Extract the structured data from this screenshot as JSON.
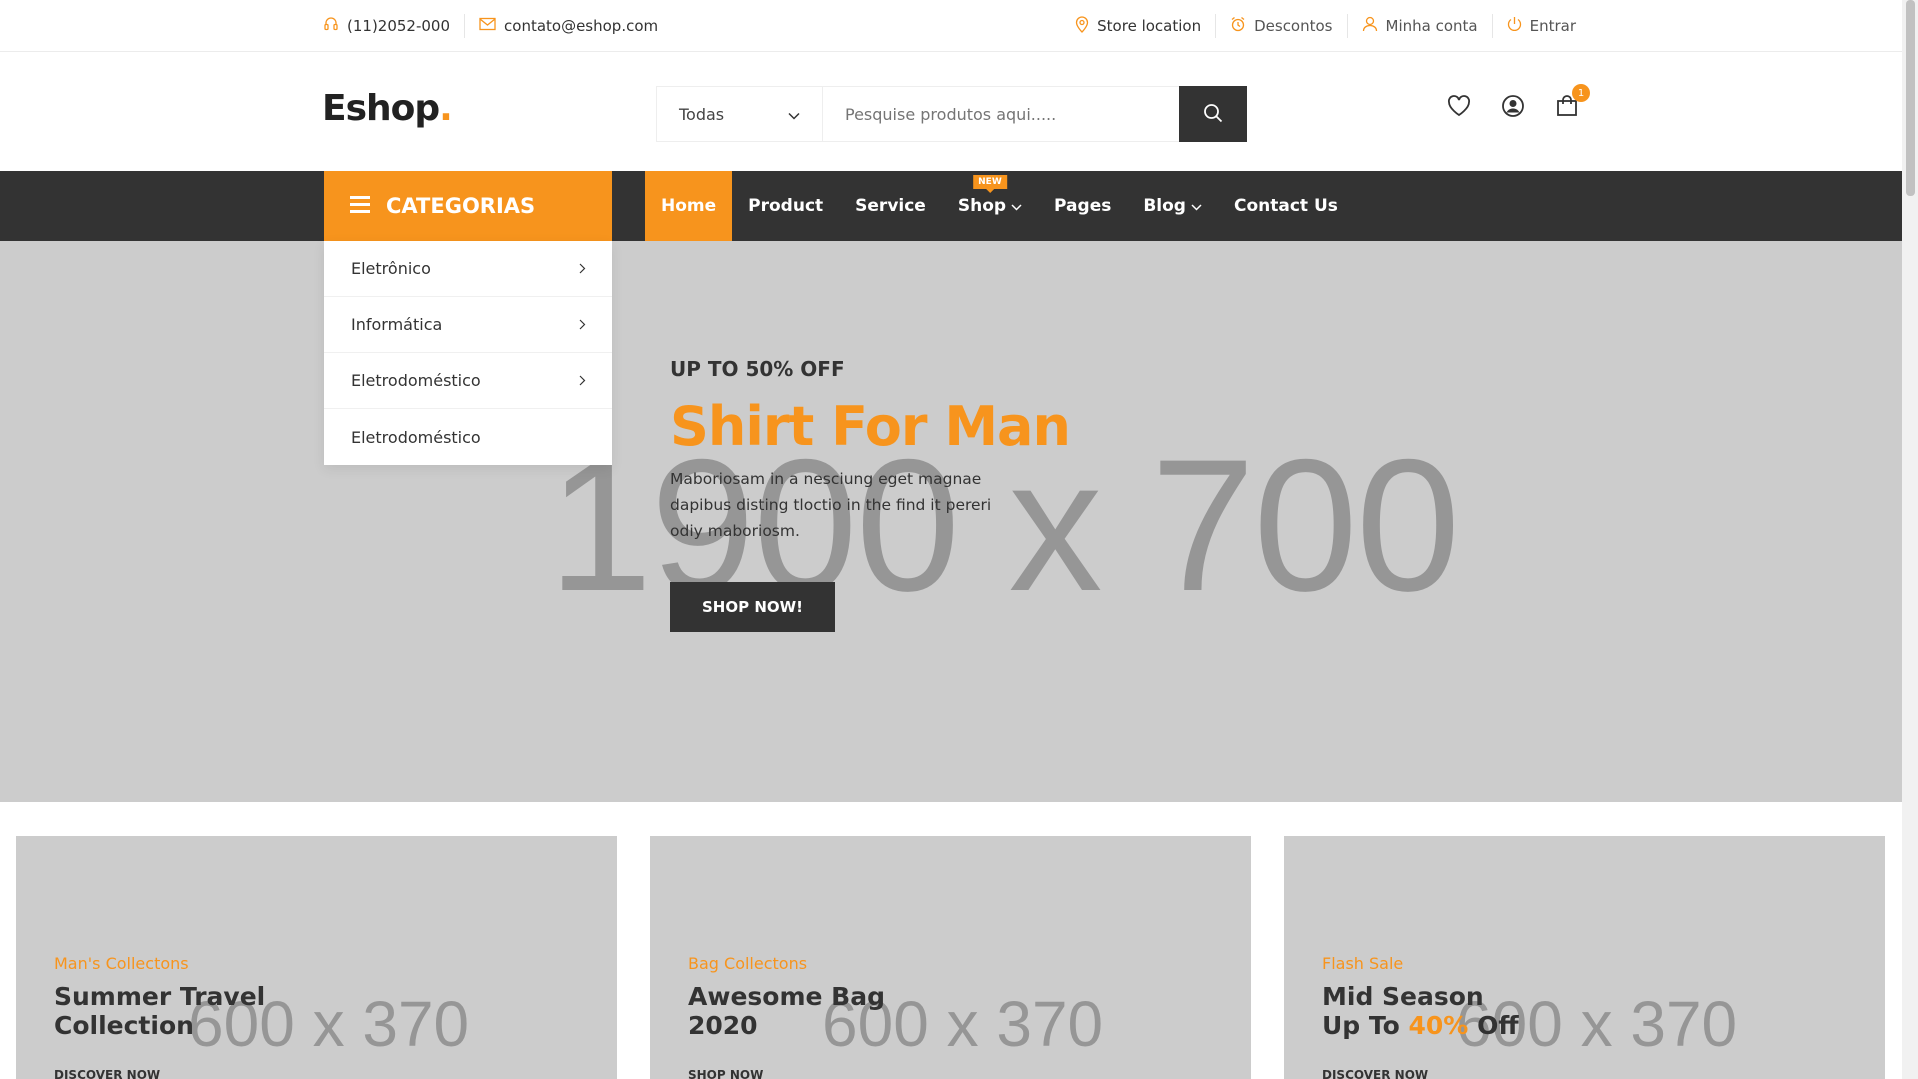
{
  "topbar": {
    "phone": "(11)2052-000",
    "email": "contato@eshop.com",
    "links": {
      "store_location": "Store location",
      "discounts": "Descontos",
      "account": "Minha conta",
      "login": "Entrar"
    }
  },
  "header": {
    "logo_text": "Eshop",
    "logo_dot": ".",
    "search": {
      "category_value": "Todas",
      "placeholder": "Pesquise produtos aqui....."
    },
    "cart_count": "1"
  },
  "nav": {
    "categories_label": "CATEGORIAS",
    "items": [
      {
        "label": "Home"
      },
      {
        "label": "Product"
      },
      {
        "label": "Service"
      },
      {
        "label": "Shop",
        "badge": "NEW"
      },
      {
        "label": "Pages"
      },
      {
        "label": "Blog"
      },
      {
        "label": "Contact Us"
      }
    ]
  },
  "category_menu": [
    {
      "label": "Eletrônico"
    },
    {
      "label": "Informática"
    },
    {
      "label": "Eletrodoméstico"
    },
    {
      "label": "Eletrodoméstico"
    }
  ],
  "hero": {
    "placeholder": "1900 x 700",
    "kicker": "UP TO 50% OFF",
    "title": "Shirt For Man",
    "description": "Maboriosam in a nesciung eget magnae dapibus disting tloctio in the find it pereri odiy maboriosm.",
    "button": "SHOP NOW!"
  },
  "promos": [
    {
      "subtitle": "Man's Collectons",
      "title_line1": "Summer Travel",
      "title_line2": "Collection",
      "placeholder": "600 x 370",
      "link": "DISCOVER NOW"
    },
    {
      "subtitle": "Bag Collectons",
      "title_line1": "Awesome Bag",
      "title_line2": "2020",
      "placeholder": "600 x 370",
      "link": "SHOP NOW"
    },
    {
      "subtitle": "Flash Sale",
      "title_line1": "Mid Season",
      "title_pre": "Up To ",
      "title_highlight": "40%",
      "title_post": " Off",
      "placeholder": "600 x 370",
      "link": "DISCOVER NOW"
    }
  ],
  "colors": {
    "accent": "#f7941d",
    "dark": "#333333",
    "placeholder_bg": "#cccccc"
  },
  "icons": [
    "headset-icon",
    "mail-icon",
    "location-pin-icon",
    "alarm-clock-icon",
    "user-icon",
    "power-icon",
    "search-icon",
    "heart-icon",
    "account-circle-icon",
    "shopping-bag-icon",
    "menu-icon",
    "chevron-down-icon",
    "chevron-right-icon"
  ]
}
